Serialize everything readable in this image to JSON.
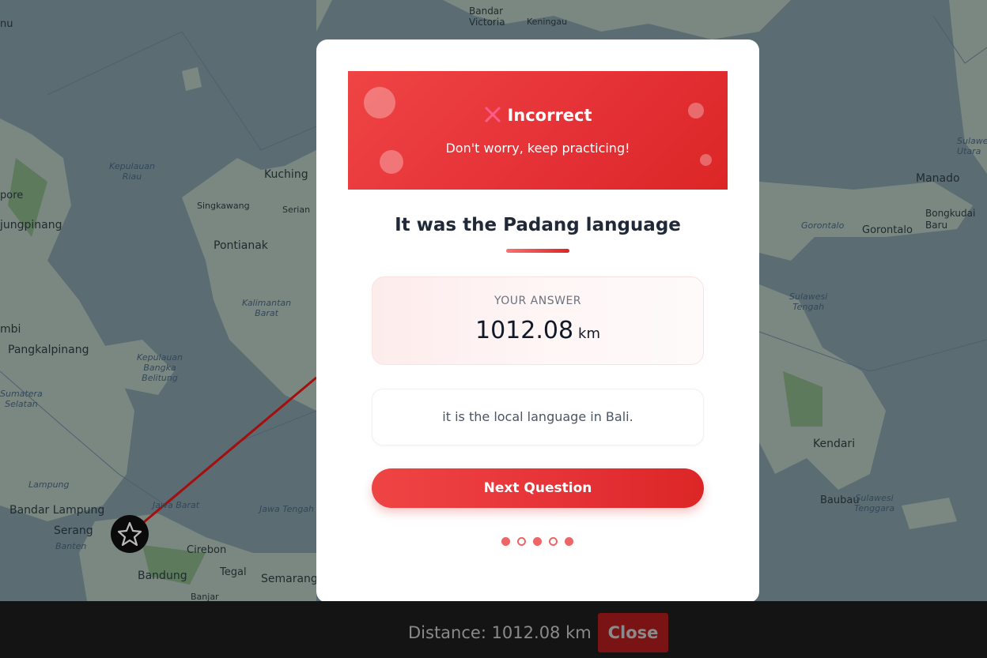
{
  "map": {
    "places": {
      "bandar_victoria": "Bandar\nVictoria",
      "keningau": "Keningau",
      "nu": "nu",
      "kuching": "Kuching",
      "kepulauan_riau": "Kepulauan\nRiau",
      "singkawang": "Singkawang",
      "serian": "Serian",
      "pore": "pore",
      "jungpinang": "jungpinang",
      "pontianak": "Pontianak",
      "kalimantan_barat": "Kalimantan\nBarat",
      "mbi": "mbi",
      "pangkalpinang": "Pangkalpinang",
      "kepulauan_bangka_belitung": "Kepulauan\nBangka\nBelitung",
      "sumatera_selatan": "Sumatera\nSelatan",
      "lampung": "Lampung",
      "bandar_lampung": "Bandar Lampung",
      "jawa_barat": "Jawa Barat",
      "serang": "Serang",
      "banten": "Banten",
      "cirebon": "Cirebon",
      "jawa_tengah": "Jawa Tengah",
      "tegal": "Tegal",
      "bandung": "Bandung",
      "semarang": "Semarang",
      "banjar": "Banjar",
      "manado": "Manado",
      "gorontalo_region": "Gorontalo",
      "gorontalo_city": "Gorontalo",
      "bongkudai_baru": "Bongkudai\nBaru",
      "sulawesi_utara": "Sulawe\nUtara",
      "sulawesi_tengah": "Sulawesi\nTengah",
      "kendari": "Kendari",
      "baubau": "Baubau",
      "sulawesi_tenggara": "Sulawesi\nTenggara"
    },
    "colors": {
      "sea": "#5b6d73",
      "land": "#7b8882",
      "forest": "#5d7a5c",
      "route": "#a50e0e"
    }
  },
  "modal": {
    "banner": {
      "title": "Incorrect",
      "subtitle": "Don't worry, keep practicing!",
      "icon": "x-icon"
    },
    "answer_title": "It was the Padang language",
    "your_answer": {
      "label": "YOUR ANSWER",
      "value": "1012.08",
      "unit": "km"
    },
    "hint": "it is the local language in Bali.",
    "next_button": "Next Question",
    "progress_dots": [
      "filled",
      "hollow",
      "filled",
      "hollow",
      "filled"
    ]
  },
  "bottom_bar": {
    "distance": "Distance: 1012.08 km",
    "close_button": "Close"
  }
}
